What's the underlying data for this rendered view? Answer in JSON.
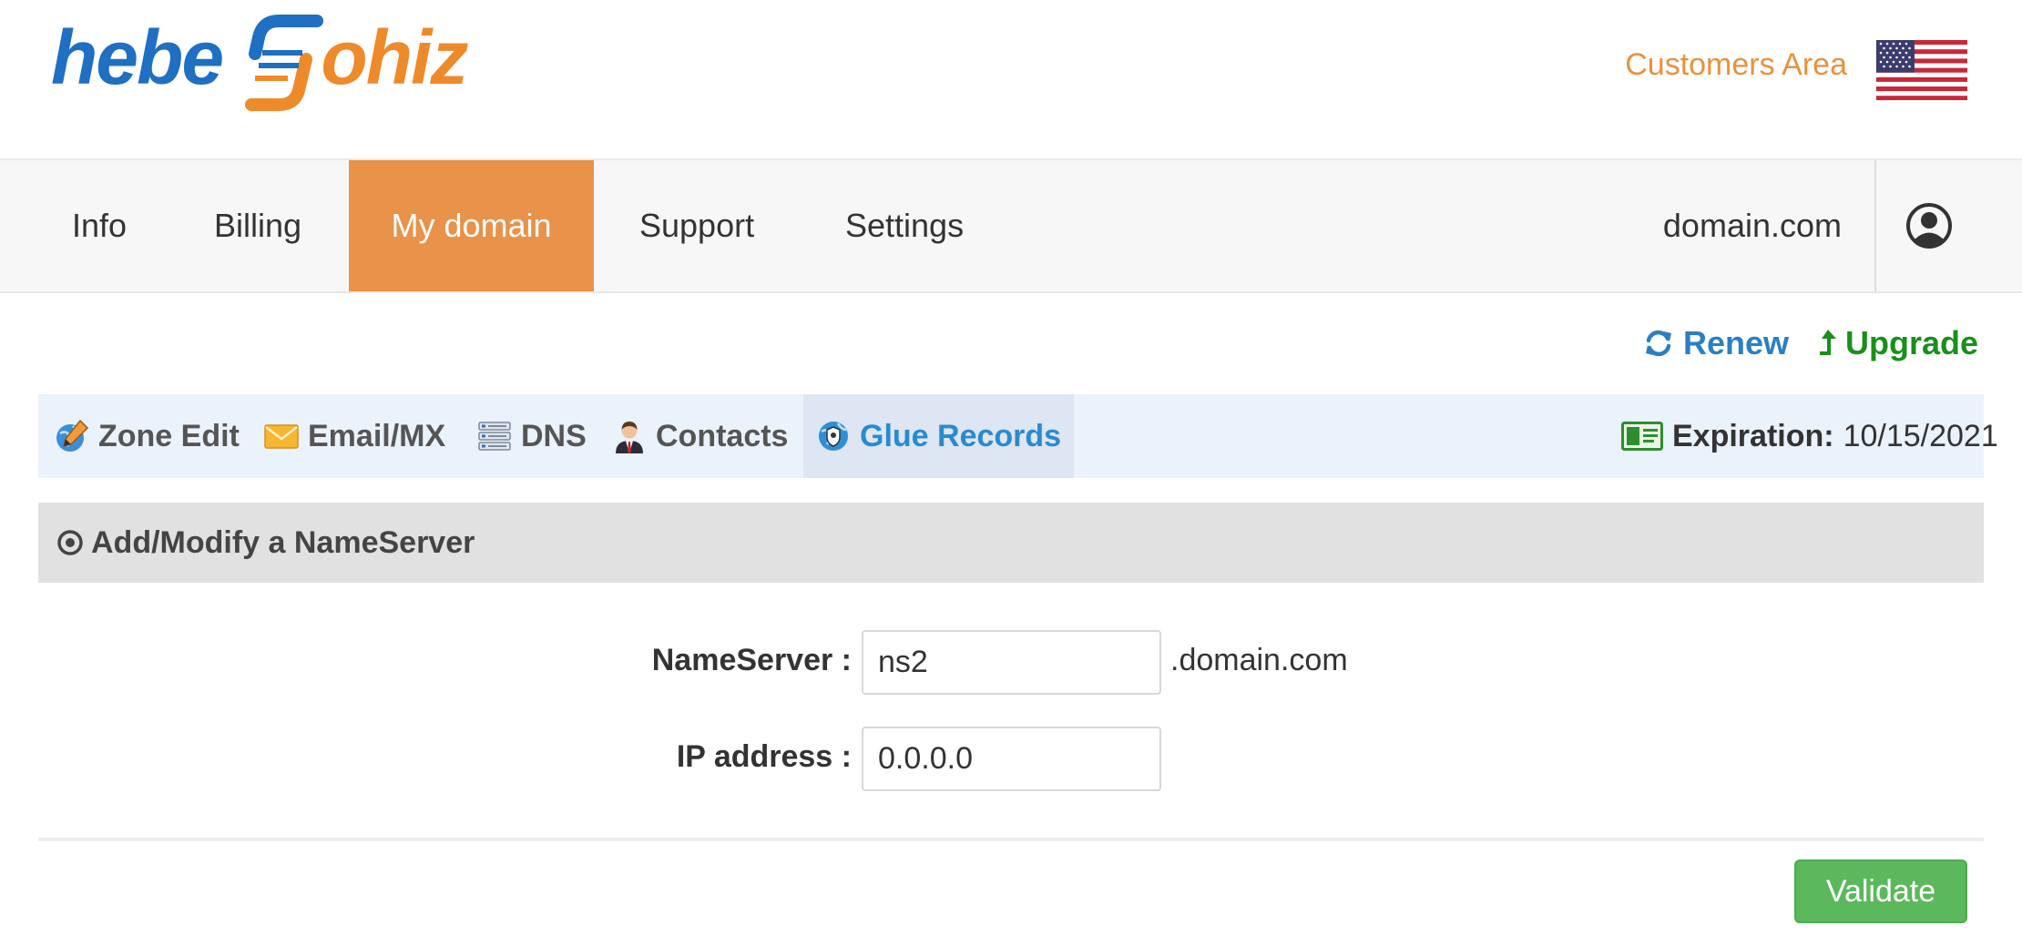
{
  "header": {
    "logo": {
      "part1": "hebe",
      "part2": "ohiz"
    },
    "customers_area": "Customers Area",
    "flag_icon": "us-flag-icon"
  },
  "mainnav": {
    "items": [
      {
        "label": "Info"
      },
      {
        "label": "Billing"
      },
      {
        "label": "My domain",
        "active": true
      },
      {
        "label": "Support"
      },
      {
        "label": "Settings"
      }
    ],
    "domain": "domain.com",
    "user_icon": "user-circle-icon"
  },
  "actions": {
    "renew": "Renew",
    "upgrade": "Upgrade"
  },
  "subtabs": {
    "items": [
      {
        "label": "Zone Edit",
        "icon": "zone-edit-icon"
      },
      {
        "label": "Email/MX",
        "icon": "envelope-icon"
      },
      {
        "label": "DNS",
        "icon": "server-list-icon"
      },
      {
        "label": "Contacts",
        "icon": "person-icon"
      },
      {
        "label": "Glue Records",
        "icon": "globe-shield-icon",
        "active": true
      }
    ],
    "expiration_label": "Expiration:",
    "expiration_value": "10/15/2021"
  },
  "section": {
    "title": "Add/Modify a NameServer"
  },
  "form": {
    "nameserver_label": "NameServer :",
    "nameserver_value": "ns2",
    "nameserver_suffix": ".domain.com",
    "ip_label": "IP address :",
    "ip_value": "0.0.0.0",
    "validate_label": "Validate"
  },
  "colors": {
    "brand_blue": "#1f6fc2",
    "brand_orange": "#ef8a2b",
    "nav_active": "#e8924a",
    "link_blue": "#2a7fc4",
    "upgrade_green": "#1a8f1a",
    "validate_green": "#5cb85c"
  }
}
